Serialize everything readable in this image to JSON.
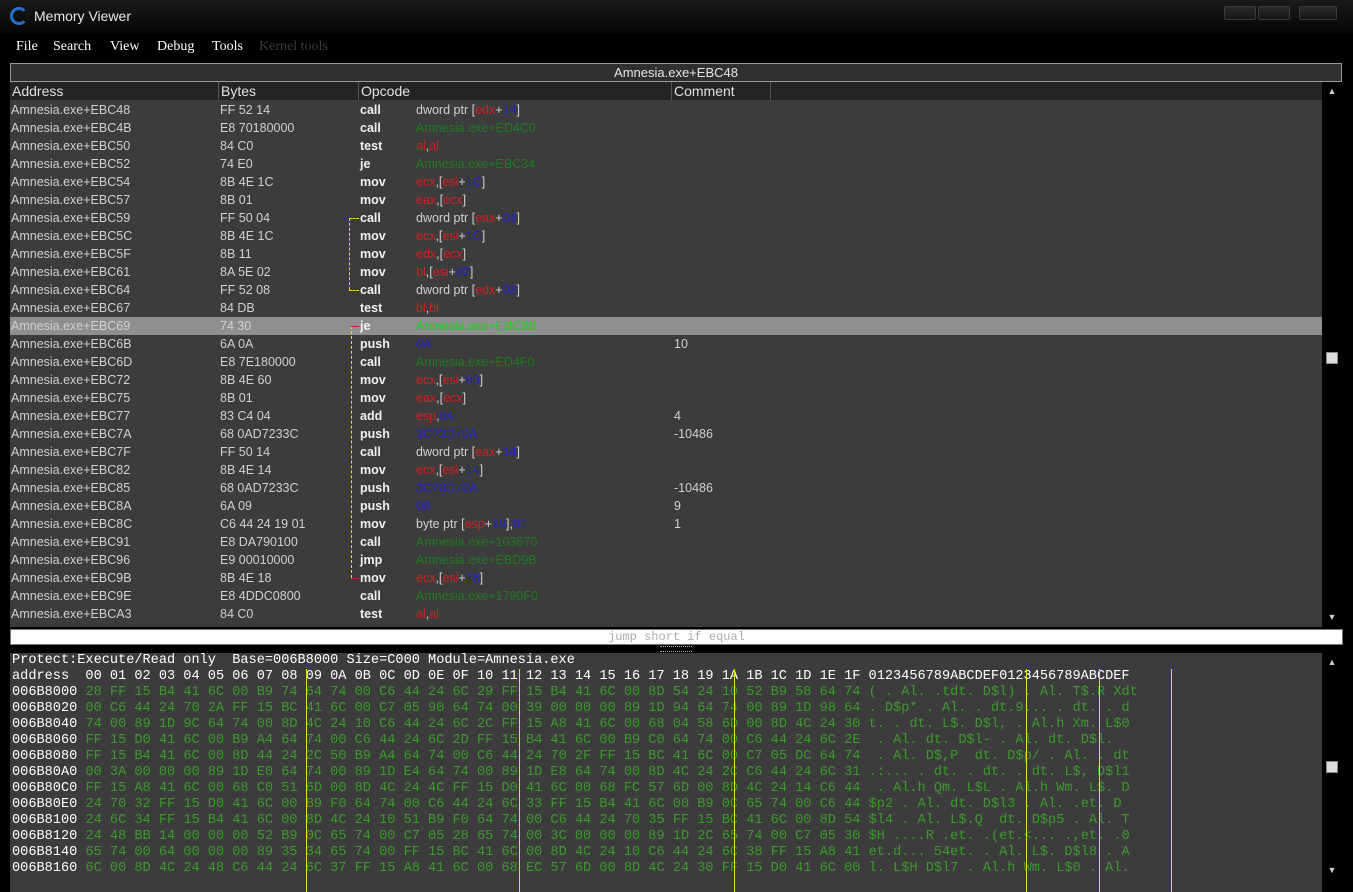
{
  "window": {
    "title": "Memory Viewer"
  },
  "menu": [
    {
      "label": "File",
      "enabled": true
    },
    {
      "label": "Search",
      "enabled": true
    },
    {
      "label": "View",
      "enabled": true
    },
    {
      "label": "Debug",
      "enabled": true
    },
    {
      "label": "Tools",
      "enabled": true
    },
    {
      "label": "Kernel tools",
      "enabled": false
    }
  ],
  "address_bar": "Amnesia.exe+EBC48",
  "disasm": {
    "columns": [
      "Address",
      "Bytes",
      "Opcode",
      "Comment"
    ],
    "rows": [
      {
        "addr": "Amnesia.exe+EBC48",
        "bytes": "FF 52 14",
        "mn": "call",
        "ops": [
          [
            "t",
            "dword ptr ["
          ],
          [
            "r",
            "edx"
          ],
          [
            "t",
            "+"
          ],
          [
            "n",
            "14"
          ],
          [
            "t",
            "]"
          ]
        ],
        "com": ""
      },
      {
        "addr": "Amnesia.exe+EBC4B",
        "bytes": "E8 70180000",
        "mn": "call",
        "ops": [
          [
            "g",
            "Amnesia.exe+ED4C0"
          ]
        ],
        "com": ""
      },
      {
        "addr": "Amnesia.exe+EBC50",
        "bytes": "84 C0",
        "mn": "test",
        "ops": [
          [
            "r",
            "al"
          ],
          [
            "t",
            ","
          ],
          [
            "r",
            "al"
          ]
        ],
        "com": ""
      },
      {
        "addr": "Amnesia.exe+EBC52",
        "bytes": "74 E0",
        "mn": "je",
        "ops": [
          [
            "g",
            "Amnesia.exe+EBC34"
          ]
        ],
        "com": ""
      },
      {
        "addr": "Amnesia.exe+EBC54",
        "bytes": "8B 4E 1C",
        "mn": "mov",
        "ops": [
          [
            "r",
            "ecx"
          ],
          [
            "t",
            ",["
          ],
          [
            "r",
            "esi"
          ],
          [
            "t",
            "+"
          ],
          [
            "n",
            "1C"
          ],
          [
            "t",
            "]"
          ]
        ],
        "com": ""
      },
      {
        "addr": "Amnesia.exe+EBC57",
        "bytes": "8B 01",
        "mn": "mov",
        "ops": [
          [
            "r",
            "eax"
          ],
          [
            "t",
            ",["
          ],
          [
            "r",
            "ecx"
          ],
          [
            "t",
            "]"
          ]
        ],
        "com": ""
      },
      {
        "addr": "Amnesia.exe+EBC59",
        "bytes": "FF 50 04",
        "mn": "call",
        "ops": [
          [
            "t",
            "dword ptr ["
          ],
          [
            "r",
            "eax"
          ],
          [
            "t",
            "+"
          ],
          [
            "n",
            "04"
          ],
          [
            "t",
            "]"
          ]
        ],
        "com": ""
      },
      {
        "addr": "Amnesia.exe+EBC5C",
        "bytes": "8B 4E 1C",
        "mn": "mov",
        "ops": [
          [
            "r",
            "ecx"
          ],
          [
            "t",
            ",["
          ],
          [
            "r",
            "esi"
          ],
          [
            "t",
            "+"
          ],
          [
            "n",
            "1C"
          ],
          [
            "t",
            "]"
          ]
        ],
        "com": ""
      },
      {
        "addr": "Amnesia.exe+EBC5F",
        "bytes": "8B 11",
        "mn": "mov",
        "ops": [
          [
            "r",
            "edx"
          ],
          [
            "t",
            ",["
          ],
          [
            "r",
            "ecx"
          ],
          [
            "t",
            "]"
          ]
        ],
        "com": ""
      },
      {
        "addr": "Amnesia.exe+EBC61",
        "bytes": "8A 5E 02",
        "mn": "mov",
        "ops": [
          [
            "r",
            "bl"
          ],
          [
            "t",
            ",["
          ],
          [
            "r",
            "esi"
          ],
          [
            "t",
            "+"
          ],
          [
            "n",
            "02"
          ],
          [
            "t",
            "]"
          ]
        ],
        "com": ""
      },
      {
        "addr": "Amnesia.exe+EBC64",
        "bytes": "FF 52 08",
        "mn": "call",
        "ops": [
          [
            "t",
            "dword ptr ["
          ],
          [
            "r",
            "edx"
          ],
          [
            "t",
            "+"
          ],
          [
            "n",
            "08"
          ],
          [
            "t",
            "]"
          ]
        ],
        "com": ""
      },
      {
        "addr": "Amnesia.exe+EBC67",
        "bytes": "84 DB",
        "mn": "test",
        "ops": [
          [
            "r",
            "bl"
          ],
          [
            "t",
            ","
          ],
          [
            "r",
            "bl"
          ]
        ],
        "com": ""
      },
      {
        "addr": "Amnesia.exe+EBC69",
        "bytes": "74 30",
        "mn": "je",
        "ops": [
          [
            "g",
            "Amnesia.exe+EBC9B"
          ]
        ],
        "com": "",
        "selected": true
      },
      {
        "addr": "Amnesia.exe+EBC6B",
        "bytes": "6A 0A",
        "mn": "push",
        "ops": [
          [
            "n",
            "0A"
          ]
        ],
        "com": "10"
      },
      {
        "addr": "Amnesia.exe+EBC6D",
        "bytes": "E8 7E180000",
        "mn": "call",
        "ops": [
          [
            "g",
            "Amnesia.exe+ED4F0"
          ]
        ],
        "com": ""
      },
      {
        "addr": "Amnesia.exe+EBC72",
        "bytes": "8B 4E 60",
        "mn": "mov",
        "ops": [
          [
            "r",
            "ecx"
          ],
          [
            "t",
            ",["
          ],
          [
            "r",
            "esi"
          ],
          [
            "t",
            "+"
          ],
          [
            "n",
            "60"
          ],
          [
            "t",
            "]"
          ]
        ],
        "com": ""
      },
      {
        "addr": "Amnesia.exe+EBC75",
        "bytes": "8B 01",
        "mn": "mov",
        "ops": [
          [
            "r",
            "eax"
          ],
          [
            "t",
            ",["
          ],
          [
            "r",
            "ecx"
          ],
          [
            "t",
            "]"
          ]
        ],
        "com": ""
      },
      {
        "addr": "Amnesia.exe+EBC77",
        "bytes": "83 C4 04",
        "mn": "add",
        "ops": [
          [
            "r",
            "esp"
          ],
          [
            "t",
            ","
          ],
          [
            "n",
            "04"
          ]
        ],
        "com": "4"
      },
      {
        "addr": "Amnesia.exe+EBC7A",
        "bytes": "68 0AD7233C",
        "mn": "push",
        "ops": [
          [
            "n",
            "3C23D70A"
          ]
        ],
        "com": "-10486"
      },
      {
        "addr": "Amnesia.exe+EBC7F",
        "bytes": "FF 50 14",
        "mn": "call",
        "ops": [
          [
            "t",
            "dword ptr ["
          ],
          [
            "r",
            "eax"
          ],
          [
            "t",
            "+"
          ],
          [
            "n",
            "14"
          ],
          [
            "t",
            "]"
          ]
        ],
        "com": ""
      },
      {
        "addr": "Amnesia.exe+EBC82",
        "bytes": "8B 4E 14",
        "mn": "mov",
        "ops": [
          [
            "r",
            "ecx"
          ],
          [
            "t",
            ",["
          ],
          [
            "r",
            "esi"
          ],
          [
            "t",
            "+"
          ],
          [
            "n",
            "14"
          ],
          [
            "t",
            "]"
          ]
        ],
        "com": ""
      },
      {
        "addr": "Amnesia.exe+EBC85",
        "bytes": "68 0AD7233C",
        "mn": "push",
        "ops": [
          [
            "n",
            "3C23D70A"
          ]
        ],
        "com": "-10486"
      },
      {
        "addr": "Amnesia.exe+EBC8A",
        "bytes": "6A 09",
        "mn": "push",
        "ops": [
          [
            "n",
            "09"
          ]
        ],
        "com": "9"
      },
      {
        "addr": "Amnesia.exe+EBC8C",
        "bytes": "C6 44 24 19 01",
        "mn": "mov",
        "ops": [
          [
            "t",
            "byte ptr ["
          ],
          [
            "r",
            "esp"
          ],
          [
            "t",
            "+"
          ],
          [
            "n",
            "19"
          ],
          [
            "t",
            "],"
          ],
          [
            "n",
            "01"
          ]
        ],
        "com": "1"
      },
      {
        "addr": "Amnesia.exe+EBC91",
        "bytes": "E8 DA790100",
        "mn": "call",
        "ops": [
          [
            "g",
            "Amnesia.exe+103670"
          ]
        ],
        "com": ""
      },
      {
        "addr": "Amnesia.exe+EBC96",
        "bytes": "E9 00010000",
        "mn": "jmp",
        "ops": [
          [
            "g",
            "Amnesia.exe+EBD9B"
          ]
        ],
        "com": ""
      },
      {
        "addr": "Amnesia.exe+EBC9B",
        "bytes": "8B 4E 18",
        "mn": "mov",
        "ops": [
          [
            "r",
            "ecx"
          ],
          [
            "t",
            ",["
          ],
          [
            "r",
            "esi"
          ],
          [
            "t",
            "+"
          ],
          [
            "n",
            "18"
          ],
          [
            "t",
            "]"
          ]
        ],
        "com": ""
      },
      {
        "addr": "Amnesia.exe+EBC9E",
        "bytes": "E8 4DDC0800",
        "mn": "call",
        "ops": [
          [
            "g",
            "Amnesia.exe+1790F0"
          ]
        ],
        "com": ""
      },
      {
        "addr": "Amnesia.exe+EBCA3",
        "bytes": "84 C0",
        "mn": "test",
        "ops": [
          [
            "r",
            "al"
          ],
          [
            "t",
            ","
          ],
          [
            "r",
            "al"
          ]
        ],
        "com": ""
      }
    ]
  },
  "status_line": "jump short if equal",
  "hex": {
    "info": "Protect:Execute/Read only  Base=006B8000 Size=C000 Module=Amnesia.exe",
    "header": "address  00 01 02 03 04 05 06 07 08 09 0A 0B 0C 0D 0E 0F 10 11 12 13 14 15 16 17 18 19 1A 1B 1C 1D 1E 1F 0123456789ABCDEF0123456789ABCDEF",
    "rows": [
      {
        "addr": "006B8000",
        "bytes": "28 FF 15 B4 41 6C 00 B9 74 64 74 00 C6 44 24 6C 29 FF 15 B4 41 6C 00 8D 54 24 10 52 B9 58 64 74",
        "ascii": "( . Al. .tdt. D$l) . Al. T$.R Xdt"
      },
      {
        "addr": "006B8020",
        "bytes": "00 C6 44 24 70 2A FF 15 BC 41 6C 00 C7 05 90 64 74 00 39 00 00 00 89 1D 94 64 74 00 89 1D 98 64",
        "ascii": ". D$p* . Al. . dt.9... . dt. . d"
      },
      {
        "addr": "006B8040",
        "bytes": "74 00 89 1D 9C 64 74 00 8D 4C 24 10 C6 44 24 6C 2C FF 15 A8 41 6C 00 68 04 58 6D 00 8D 4C 24 30",
        "ascii": "t. . dt. L$. D$l, . Al.h Xm. L$0"
      },
      {
        "addr": "006B8060",
        "bytes": "FF 15 D0 41 6C 00 B9 A4 64 74 00 C6 44 24 6C 2D FF 15 B4 41 6C 00 B9 C0 64 74 00 C6 44 24 6C 2E",
        "ascii": " . Al. dt. D$l- . Al. dt. D$l."
      },
      {
        "addr": "006B8080",
        "bytes": "FF 15 B4 41 6C 00 8D 44 24 2C 50 B9 A4 64 74 00 C6 44 24 70 2F FF 15 BC 41 6C 00 C7 05 DC 64 74",
        "ascii": " . Al. D$,P  dt. D$p/ . Al. . dt"
      },
      {
        "addr": "006B80A0",
        "bytes": "00 3A 00 00 00 89 1D E0 64 74 00 89 1D E4 64 74 00 89 1D E8 64 74 00 8D 4C 24 2C C6 44 24 6C 31",
        "ascii": ".:... . dt. . dt. . dt. L$, D$l1"
      },
      {
        "addr": "006B80C0",
        "bytes": "FF 15 A8 41 6C 00 68 C0 51 6D 00 8D 4C 24 4C FF 15 D0 41 6C 00 68 FC 57 6D 00 8D 4C 24 14 C6 44",
        "ascii": " . Al.h Qm. L$L . Al.h Wm. L$. D"
      },
      {
        "addr": "006B80E0",
        "bytes": "24 70 32 FF 15 D0 41 6C 00 B9 F0 64 74 00 C6 44 24 6C 33 FF 15 B4 41 6C 00 B9 0C 65 74 00 C6 44",
        "ascii": "$p2 . Al. dt. D$l3 . Al. .et. D"
      },
      {
        "addr": "006B8100",
        "bytes": "24 6C 34 FF 15 B4 41 6C 00 8D 4C 24 10 51 B9 F0 64 74 00 C6 44 24 70 35 FF 15 BC 41 6C 00 8D 54",
        "ascii": "$l4 . Al. L$.Q  dt. D$p5 . Al. T"
      },
      {
        "addr": "006B8120",
        "bytes": "24 48 BB 14 00 00 00 52 B9 0C 65 74 00 C7 05 28 65 74 00 3C 00 00 00 89 1D 2C 65 74 00 C7 05 30",
        "ascii": "$H ....R .et. .(et.<... .,et. .0"
      },
      {
        "addr": "006B8140",
        "bytes": "65 74 00 64 00 00 00 89 35 34 65 74 00 FF 15 BC 41 6C 00 8D 4C 24 10 C6 44 24 6C 38 FF 15 A8 41",
        "ascii": "et.d... 54et. . Al. L$. D$l8 . A"
      },
      {
        "addr": "006B8160",
        "bytes": "6C 00 8D 4C 24 48 C6 44 24 6C 37 FF 15 A8 41 6C 00 68 EC 57 6D 00 8D 4C 24 30 FF 15 D0 41 6C 00",
        "ascii": "l. L$H D$l7 . Al.h Wm. L$0 . Al."
      }
    ]
  }
}
